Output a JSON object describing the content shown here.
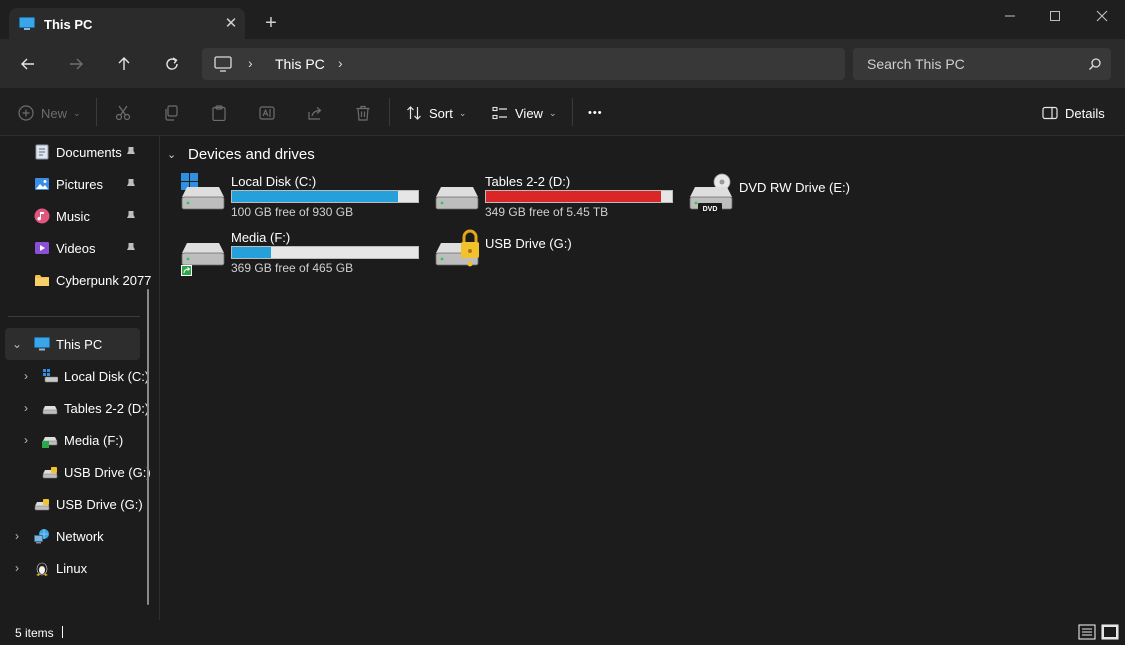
{
  "window": {
    "tab_title": "This PC",
    "tab_close": "✕",
    "new_tab": "+"
  },
  "address": {
    "crumbs": [
      "This PC"
    ],
    "search_placeholder": "Search This PC"
  },
  "commands": {
    "new_label": "New",
    "sort_label": "Sort",
    "view_label": "View",
    "more_label": "•••",
    "details_label": "Details"
  },
  "sidebar": {
    "quick_access": [
      {
        "label": "Documents",
        "icon": "documents-icon",
        "pinned": true
      },
      {
        "label": "Pictures",
        "icon": "pictures-icon",
        "pinned": true
      },
      {
        "label": "Music",
        "icon": "music-icon",
        "pinned": true
      },
      {
        "label": "Videos",
        "icon": "videos-icon",
        "pinned": true
      },
      {
        "label": "Cyberpunk 2077",
        "icon": "folder-icon",
        "pinned": false
      }
    ],
    "this_pc": "This PC",
    "drives": [
      {
        "label": "Local Disk (C:)"
      },
      {
        "label": "Tables 2-2 (D:)"
      },
      {
        "label": "Media (F:)"
      },
      {
        "label": "USB Drive (G:)"
      }
    ],
    "usb_root": "USB Drive (G:)",
    "network": "Network",
    "linux": "Linux"
  },
  "content": {
    "group_title": "Devices and drives",
    "drives": [
      {
        "name": "Local Disk (C:)",
        "free_text": "100 GB free of 930 GB",
        "used_fraction": 0.89,
        "bar_color": "#26a0da"
      },
      {
        "name": "Tables 2-2 (D:)",
        "free_text": "349 GB free of 5.45 TB",
        "used_fraction": 0.94,
        "bar_color": "#da2626"
      },
      {
        "name": "DVD RW Drive (E:)",
        "free_text": "",
        "dvd_label": "DVD"
      },
      {
        "name": "Media (F:)",
        "free_text": "369 GB free of 465 GB",
        "used_fraction": 0.21,
        "bar_color": "#26a0da"
      },
      {
        "name": "USB Drive (G:)",
        "free_text": ""
      }
    ]
  },
  "status": {
    "item_count": "5 items"
  },
  "colors": {
    "accent_bar": "#26a0da",
    "full_bar": "#da2626",
    "lock": "#f2c12e"
  }
}
